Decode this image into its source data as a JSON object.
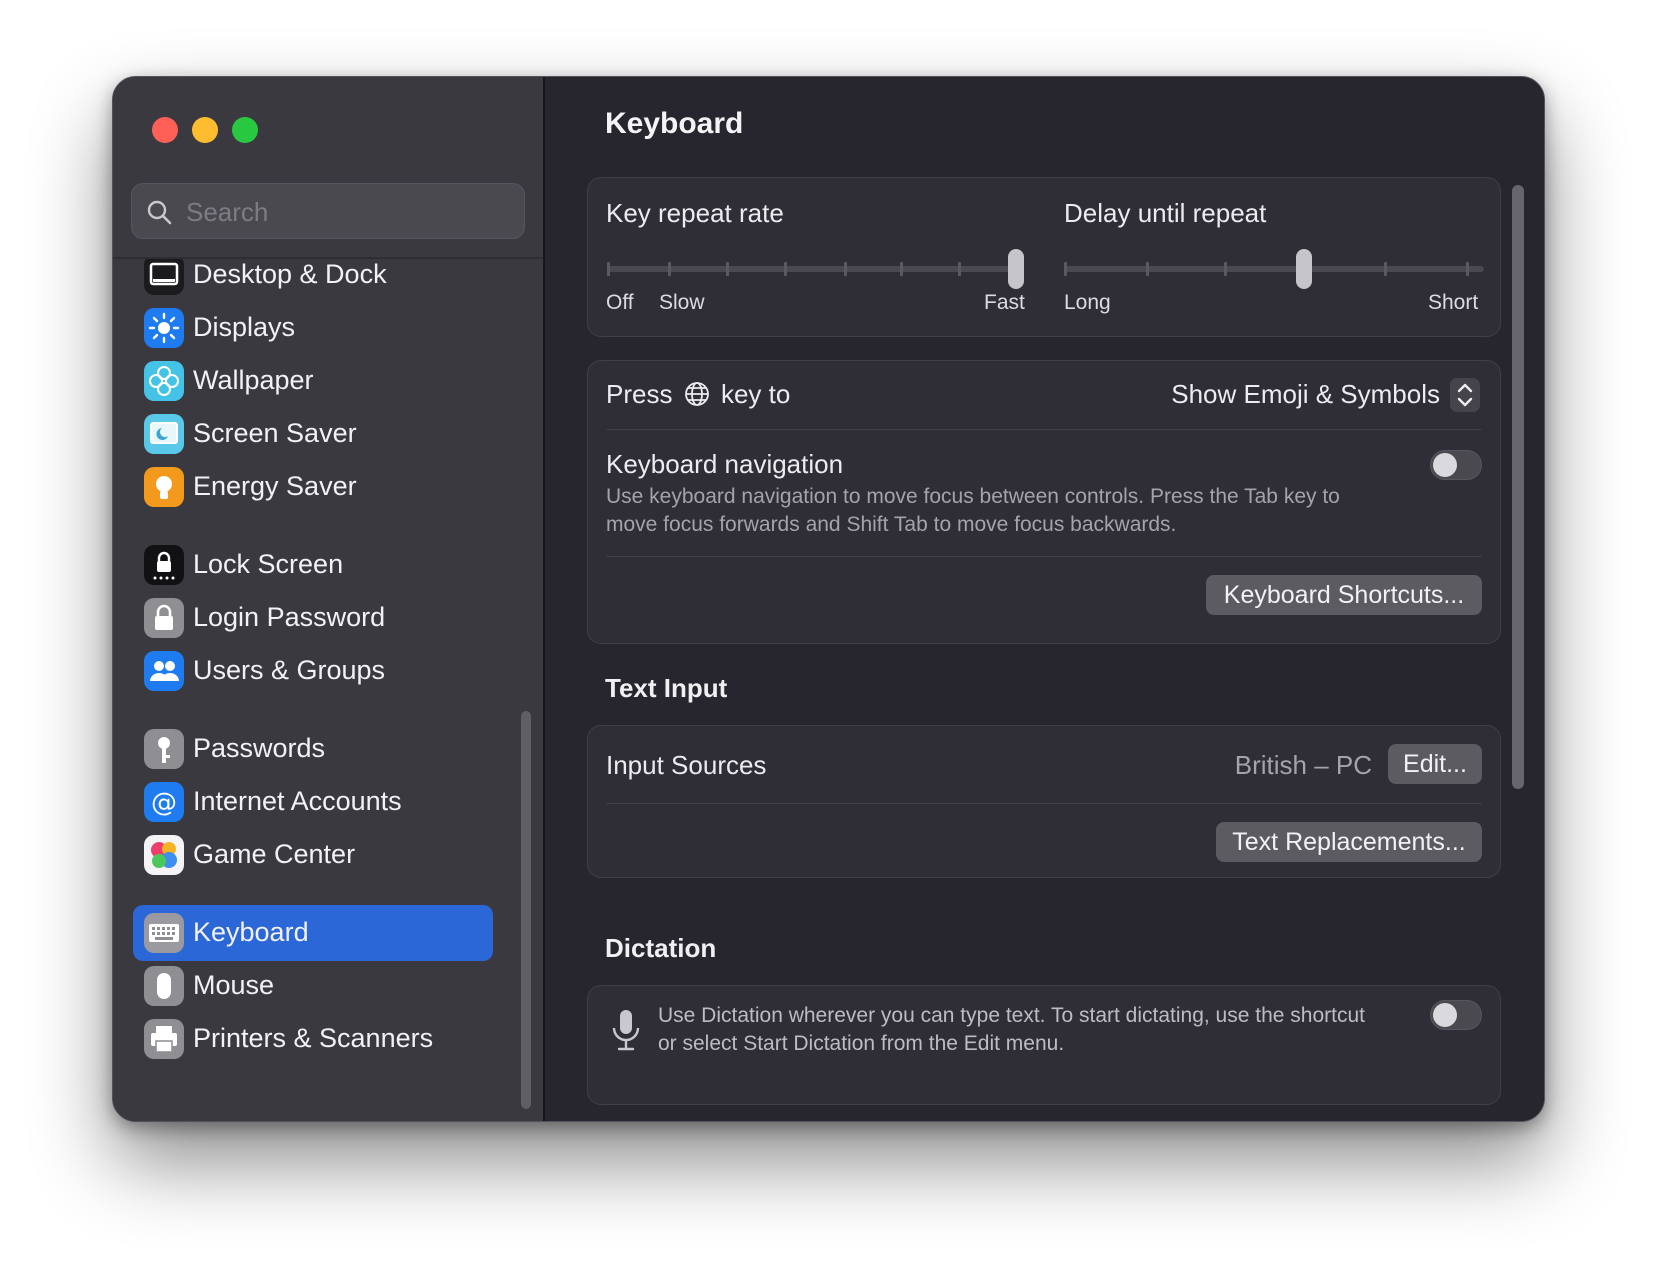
{
  "sidebar": {
    "search_placeholder": "Search",
    "items": [
      {
        "label": "Desktop & Dock",
        "icon": "desktop-dock-icon"
      },
      {
        "label": "Displays",
        "icon": "displays-icon"
      },
      {
        "label": "Wallpaper",
        "icon": "wallpaper-icon"
      },
      {
        "label": "Screen Saver",
        "icon": "screen-saver-icon"
      },
      {
        "label": "Energy Saver",
        "icon": "energy-saver-icon"
      },
      {
        "label": "Lock Screen",
        "icon": "lock-screen-icon"
      },
      {
        "label": "Login Password",
        "icon": "login-password-icon"
      },
      {
        "label": "Users & Groups",
        "icon": "users-groups-icon"
      },
      {
        "label": "Passwords",
        "icon": "passwords-icon"
      },
      {
        "label": "Internet Accounts",
        "icon": "internet-accounts-icon"
      },
      {
        "label": "Game Center",
        "icon": "game-center-icon"
      },
      {
        "label": "Keyboard",
        "icon": "keyboard-icon",
        "selected": true
      },
      {
        "label": "Mouse",
        "icon": "mouse-icon"
      },
      {
        "label": "Printers & Scanners",
        "icon": "printers-scanners-icon"
      }
    ]
  },
  "main": {
    "title": "Keyboard",
    "key_repeat": {
      "label": "Key repeat rate",
      "min_label": "Off",
      "slow_label": "Slow",
      "max_label": "Fast",
      "value_fraction": 1.0
    },
    "delay_repeat": {
      "label": "Delay until repeat",
      "min_label": "Long",
      "max_label": "Short",
      "value_fraction": 0.6
    },
    "press_key": {
      "label_before": "Press",
      "label_after": "key to",
      "value": "Show Emoji & Symbols"
    },
    "keyboard_navigation": {
      "label": "Keyboard navigation",
      "description": "Use keyboard navigation to move focus between controls. Press the Tab key to move focus forwards and Shift Tab to move focus backwards.",
      "enabled": false
    },
    "keyboard_shortcuts_button": "Keyboard Shortcuts...",
    "text_input": {
      "title": "Text Input",
      "input_sources_label": "Input Sources",
      "input_sources_value": "British – PC",
      "edit_button": "Edit...",
      "text_replacements_button": "Text Replacements..."
    },
    "dictation": {
      "title": "Dictation",
      "description": "Use Dictation wherever you can type text. To start dictating, use the shortcut or select Start Dictation from the Edit menu.",
      "enabled": false
    }
  },
  "colors": {
    "accent": "#2b67d7",
    "close": "#fe5f57",
    "minimize": "#febc2e",
    "maximize": "#28c840"
  }
}
